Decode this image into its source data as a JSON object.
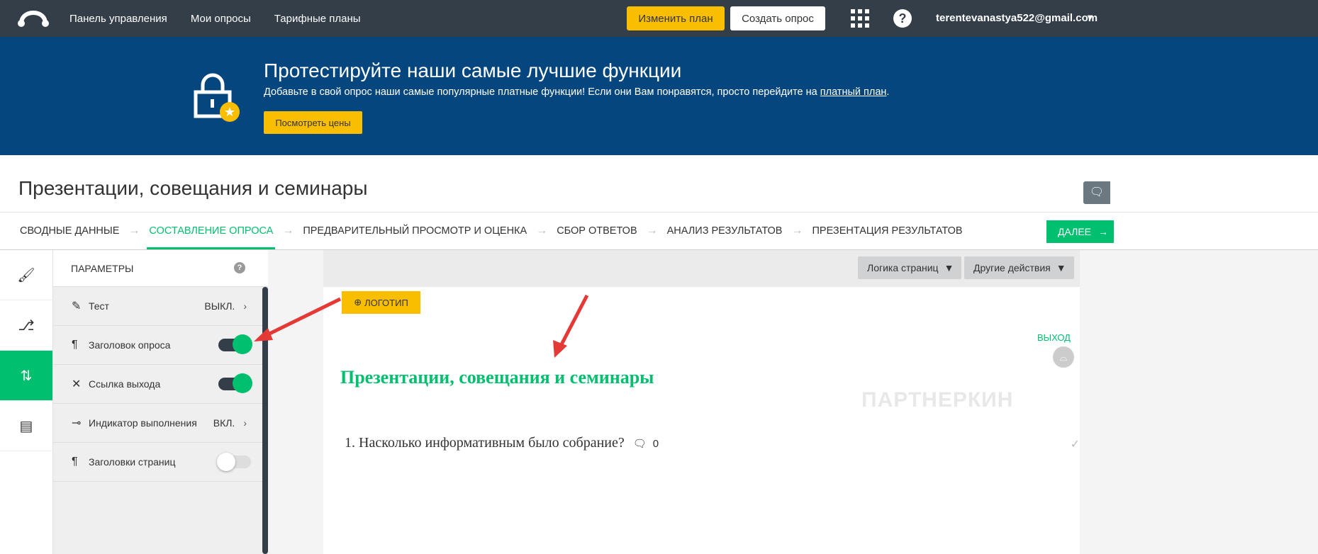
{
  "topbar": {
    "nav": [
      "Панель управления",
      "Мои опросы",
      "Тарифные планы"
    ],
    "upgrade": "Изменить план",
    "create": "Создать опрос",
    "help": "?",
    "email": "terentevanastya522@gmail.com",
    "caret": "▼"
  },
  "banner": {
    "title": "Протестируйте наши самые лучшие функции",
    "text": "Добавьте в свой опрос наши самые популярные платные функции! Если они Вам понравятся, просто перейдите на ",
    "link": "платный план",
    "end": ".",
    "button": "Посмотреть цены"
  },
  "survey_title": "Презентации, совещания и семинары",
  "steps": [
    "СВОДНЫЕ ДАННЫЕ",
    "СОСТАВЛЕНИЕ ОПРОСА",
    "ПРЕДВАРИТЕЛЬНЫЙ ПРОСМОТР И ОЦЕНКА",
    "СБОР ОТВЕТОВ",
    "АНАЛИЗ РЕЗУЛЬТАТОВ",
    "ПРЕЗЕНТАЦИЯ РЕЗУЛЬТАТОВ"
  ],
  "next": "ДАЛЕЕ",
  "panel": {
    "header": "ПАРАМЕТРЫ",
    "help": "?",
    "rows": [
      {
        "label": "Тест",
        "value": "ВЫКЛ."
      },
      {
        "label": "Заголовок опроса",
        "on": true
      },
      {
        "label": "Ссылка выхода",
        "on": true
      },
      {
        "label": "Индикатор выполнения",
        "value": "ВКЛ."
      },
      {
        "label": "Заголовки страниц",
        "on": false
      }
    ]
  },
  "toolbar": {
    "page_logic": "Логика страниц",
    "other": "Другие действия"
  },
  "page": {
    "logo": "ЛОГОТИП",
    "exit": "ВЫХОД",
    "title": "Презентации, совещания и семинары",
    "question": "1. Насколько информативным было собрание?",
    "comments": "0"
  },
  "watermark": "ПАРТНЕРКИН",
  "colors": {
    "accent": "#00bf6f",
    "topbar": "#333e48",
    "banner": "#05467e",
    "yellow": "#f9be00",
    "annotation": "#e53935"
  }
}
